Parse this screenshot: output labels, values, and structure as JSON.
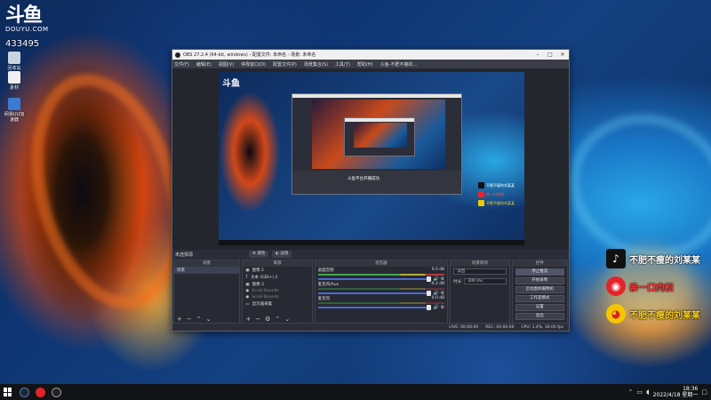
{
  "desktop": {
    "logo_glyph": "斗鱼",
    "logo_sub": "DOUYU.COM",
    "room_id": "433495",
    "icons": [
      {
        "label": "回收站"
      },
      {
        "label": "素材"
      },
      {
        "label": "网易UU加速器"
      }
    ]
  },
  "obs": {
    "title": "OBS 27.2.4 (64-bit, windows) - 配置文件: 未命名 - 场景: 未命名",
    "menu": [
      "文件(F)",
      "编辑(E)",
      "视图(V)",
      "停靠窗口(D)",
      "配置文件(P)",
      "场景集合(S)",
      "工具(T)",
      "帮助(H)",
      "斗鱼-不肥不瘦的..."
    ],
    "preview_logo": "斗鱼",
    "nested_banner": "斗鱼平台开播成功",
    "scene_label": "未选择源",
    "chip_props": "属性",
    "chip_filters": "滤镜",
    "panels": {
      "scenes_title": "场景",
      "sources_title": "来源",
      "mixer_title": "混音器",
      "transitions_title": "场景转场",
      "controls_title": "控件"
    },
    "scenes": [
      "场景"
    ],
    "sources": [
      {
        "icon": "▣",
        "name": "图像 2"
      },
      {
        "icon": "T",
        "name": "文本 (GDI+) 2"
      },
      {
        "icon": "▣",
        "name": "图像 3"
      },
      {
        "icon": "◉",
        "name": "Scroll Bounds"
      },
      {
        "icon": "◉",
        "name": "Scroll Bounds"
      },
      {
        "icon": "▭",
        "name": "显示器采集"
      }
    ],
    "mixer": [
      {
        "name": "桌面音频",
        "db": "0.0 dB"
      },
      {
        "name": "麦克风/Aux",
        "db": "-4.2 dB"
      },
      {
        "name": "麦克风",
        "db": "0.0 dB"
      }
    ],
    "transition": {
      "type": "淡出",
      "label": "时长",
      "duration": "300 ms"
    },
    "controls": [
      "停止推流",
      "开始录制",
      "启动虚拟摄像机",
      "工作室模式",
      "设置",
      "退出"
    ],
    "status": {
      "live": "LIVE: 00:00:00",
      "rec": "REC: 00:00:00",
      "cpu": "CPU: 1.4%, 30.00 fps"
    }
  },
  "social": [
    {
      "text": "不肥不瘦的刘某某",
      "color": "#ffffff",
      "badge_bg": "#111111",
      "icon": "tiktok-icon"
    },
    {
      "text": "亲一口肉松",
      "color": "#ff3b3b",
      "badge_bg": "#e3242b",
      "icon": "douyu-icon"
    },
    {
      "text": "不肥不瘦的刘某某",
      "color": "#ffd21f",
      "badge_bg": "#f6c700",
      "icon": "weibo-icon"
    }
  ],
  "taskbar": {
    "time": "18:36",
    "date": "2022/4/18 星期一"
  }
}
